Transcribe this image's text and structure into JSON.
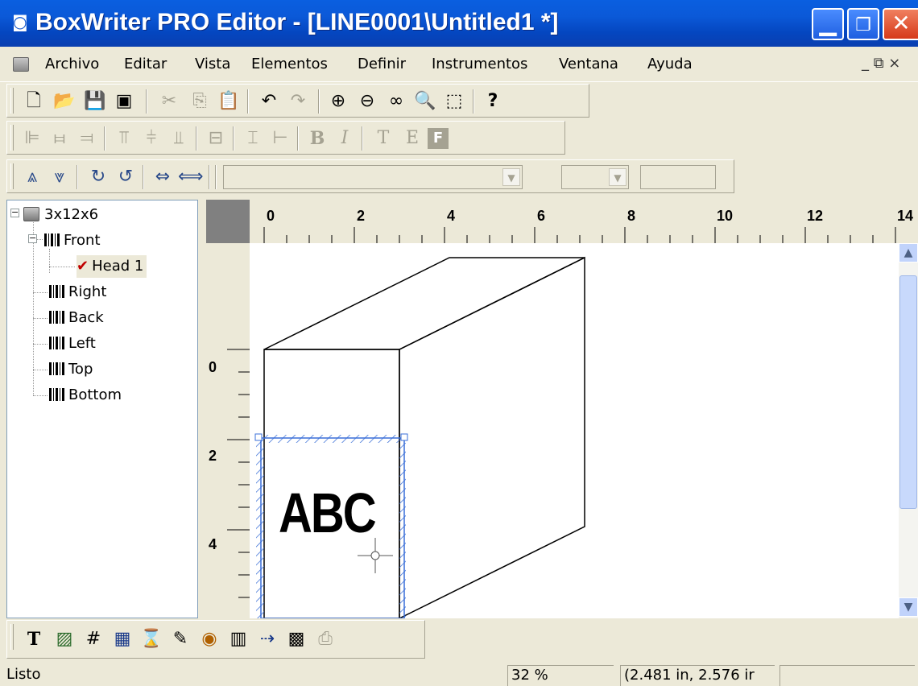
{
  "window": {
    "title": "BoxWriter PRO Editor - [LINE0001\\Untitled1 *]",
    "app_icon": "bw-icon",
    "controls": [
      "minimize-icon",
      "restore-icon",
      "close-icon"
    ]
  },
  "menu": {
    "items": [
      "Archivo",
      "Editar",
      "Vista",
      "Elementos",
      "Definir",
      "Instrumentos",
      "Ventana",
      "Ayuda"
    ],
    "mdi_controls": "_ ⧉ ×"
  },
  "toolbar1": {
    "icons": [
      "new-icon",
      "open-icon",
      "save-icon",
      "save-all-icon",
      "cut-icon",
      "copy-icon",
      "paste-icon",
      "undo-icon",
      "redo-icon",
      "zoom-in-icon",
      "zoom-out-icon",
      "zoom-fit-icon",
      "zoom-icon",
      "zoom-area-icon",
      "help-icon"
    ]
  },
  "toolbar2": {
    "icons": [
      "align-left-icon",
      "align-center-icon",
      "align-right-icon",
      "align-top-icon",
      "align-middle-icon",
      "align-bottom-icon",
      "same-width-icon",
      "space-vertical-icon",
      "space-horizontal-icon",
      "bold-icon",
      "italic-icon",
      "text-t-icon",
      "text-e-icon",
      "text-f-icon"
    ],
    "bold_label": "B",
    "italic_label": "I"
  },
  "toolbar3": {
    "icons": [
      "flip-vertical-icon",
      "flip-vertical-2-icon",
      "rotate-cw-icon",
      "rotate-ccw-icon",
      "mirror-icon",
      "mirror-2-icon"
    ],
    "font_combo_value": "",
    "size_combo_value": "",
    "extra_field_value": ""
  },
  "tree": {
    "root": "3x12x6",
    "items": [
      {
        "label": "Front",
        "expanded": true
      },
      {
        "label": "Head 1",
        "child": true,
        "selected": true
      },
      {
        "label": "Right"
      },
      {
        "label": "Back"
      },
      {
        "label": "Left"
      },
      {
        "label": "Top"
      },
      {
        "label": "Bottom"
      }
    ]
  },
  "rulers": {
    "horizontal": [
      "0",
      "2",
      "4",
      "6",
      "8",
      "10",
      "12",
      "14"
    ],
    "vertical": [
      "0",
      "2",
      "4"
    ]
  },
  "canvas": {
    "box_text": "ABC"
  },
  "element_toolbar": {
    "icons": [
      "text-tool-icon",
      "image-tool-icon",
      "counter-tool-icon",
      "date-tool-icon",
      "expiry-tool-icon",
      "shift-tool-icon",
      "logo-tool-icon",
      "barcode-tool-icon",
      "serial-tool-icon",
      "datamatrix-tool-icon",
      "disabled-tool-icon"
    ]
  },
  "status": {
    "text": "Listo",
    "zoom": "32 %",
    "coords": "(2.481 in, 2.576 ir",
    "extra": ""
  }
}
